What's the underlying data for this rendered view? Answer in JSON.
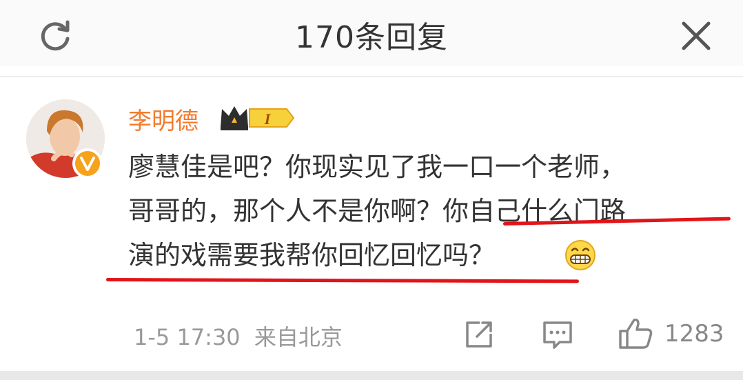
{
  "header": {
    "title": "170条回复"
  },
  "comment": {
    "username": "李明德",
    "vip_level": "I",
    "lines": [
      "廖慧佳是吧？你现实见了我一口一个老师，",
      "哥哥的，那个人不是你啊？你自己什么门路",
      "演的戏需要我帮你回忆回忆吗？"
    ],
    "time": "1-5 17:30",
    "source": "来自北京",
    "like_count": "1283"
  },
  "colors": {
    "username": "#f47a2c",
    "underline": "#e1141a",
    "text": "#333333",
    "meta": "#999999"
  },
  "icons": {
    "refresh": "refresh-icon",
    "close": "close-icon",
    "share": "share-icon",
    "comment": "comment-icon",
    "like": "thumbs-up-icon",
    "verified": "verified-v-icon",
    "crown": "crown-icon",
    "emoji": "grin-emoji-icon"
  }
}
